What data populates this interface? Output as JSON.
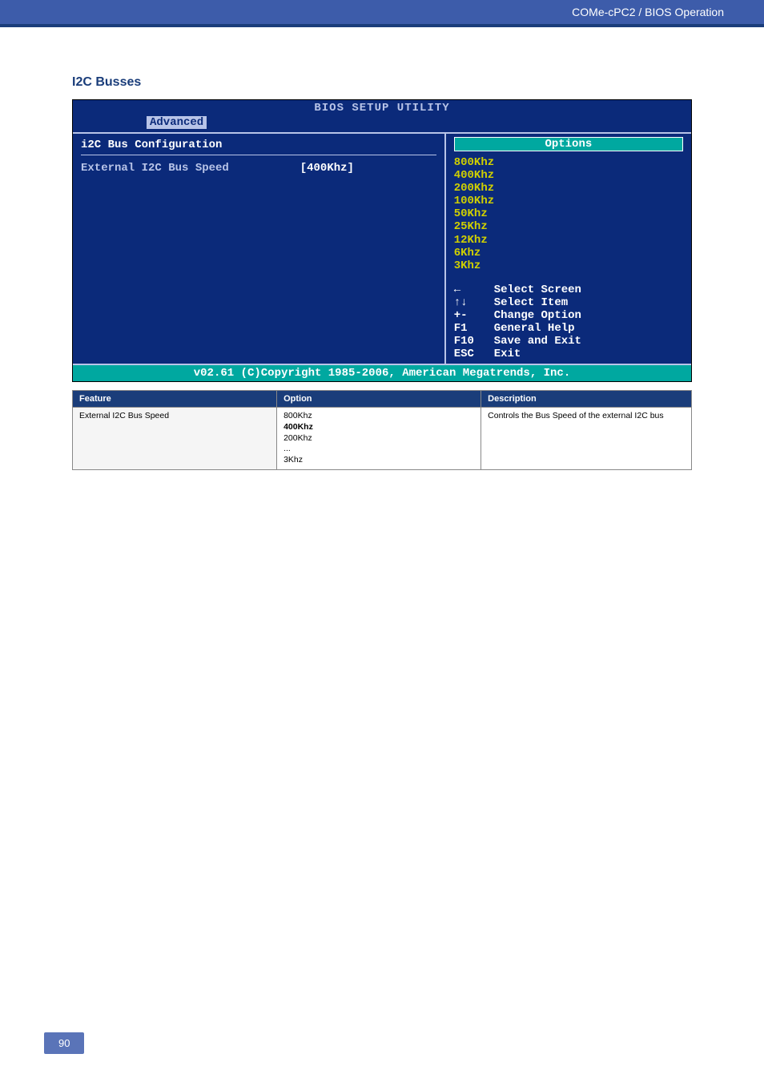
{
  "header": {
    "doc_title": "COMe-cPC2 / BIOS Operation"
  },
  "section_title": "I2C Busses",
  "bios": {
    "title": "BIOS SETUP UTILITY",
    "tab_main": "Advanced",
    "left_title": "i2C Bus Configuration",
    "setting_label": "External I2C Bus Speed",
    "setting_value": "[400Khz]",
    "options_header": "Options",
    "options": [
      "800Khz",
      "400Khz",
      "200Khz",
      "100Khz",
      "50Khz",
      "25Khz",
      "12Khz",
      "6Khz",
      "3Khz"
    ],
    "help": [
      {
        "key": "←",
        "text": "Select Screen"
      },
      {
        "key": "↑↓",
        "text": "Select Item"
      },
      {
        "key": "+-",
        "text": "Change Option"
      },
      {
        "key": "F1",
        "text": "General Help"
      },
      {
        "key": "F10",
        "text": "Save and Exit"
      },
      {
        "key": "ESC",
        "text": "Exit"
      }
    ],
    "footer": "v02.61 (C)Copyright 1985-2006, American Megatrends, Inc."
  },
  "table": {
    "headers": [
      "Feature",
      "Option",
      "Description"
    ],
    "rows": [
      {
        "feature": "External I2C Bus Speed",
        "option": "800Khz\n400Khz\n200Khz\n...\n3Khz",
        "option_bold_line": 1,
        "description": "Controls the Bus Speed of the external I2C bus"
      }
    ]
  },
  "page_number": "90"
}
